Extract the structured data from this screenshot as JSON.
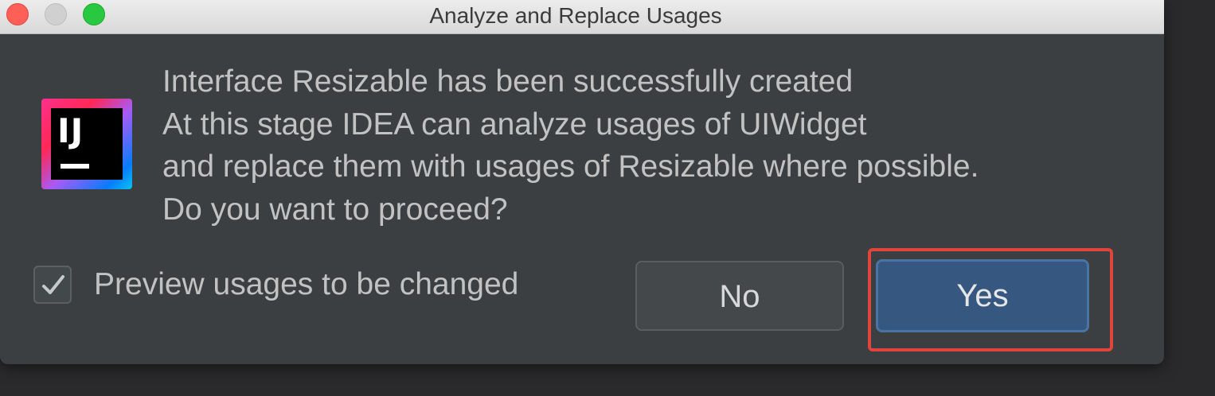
{
  "window": {
    "title": "Analyze and Replace Usages"
  },
  "app_icon": {
    "name": "intellij-idea-icon",
    "text": "IJ"
  },
  "message": {
    "lines": [
      "Interface Resizable has been successfully created",
      "At this stage IDEA can analyze usages of UIWidget",
      "and replace them with usages of Resizable where possible.",
      "Do you want to proceed?"
    ]
  },
  "options": {
    "preview_label": "Preview usages to be changed",
    "preview_checked": true
  },
  "buttons": {
    "no_label": "No",
    "yes_label": "Yes"
  },
  "colors": {
    "dialog_bg": "#3c3f41",
    "primary_button": "#365880",
    "highlight": "#e0443a"
  }
}
